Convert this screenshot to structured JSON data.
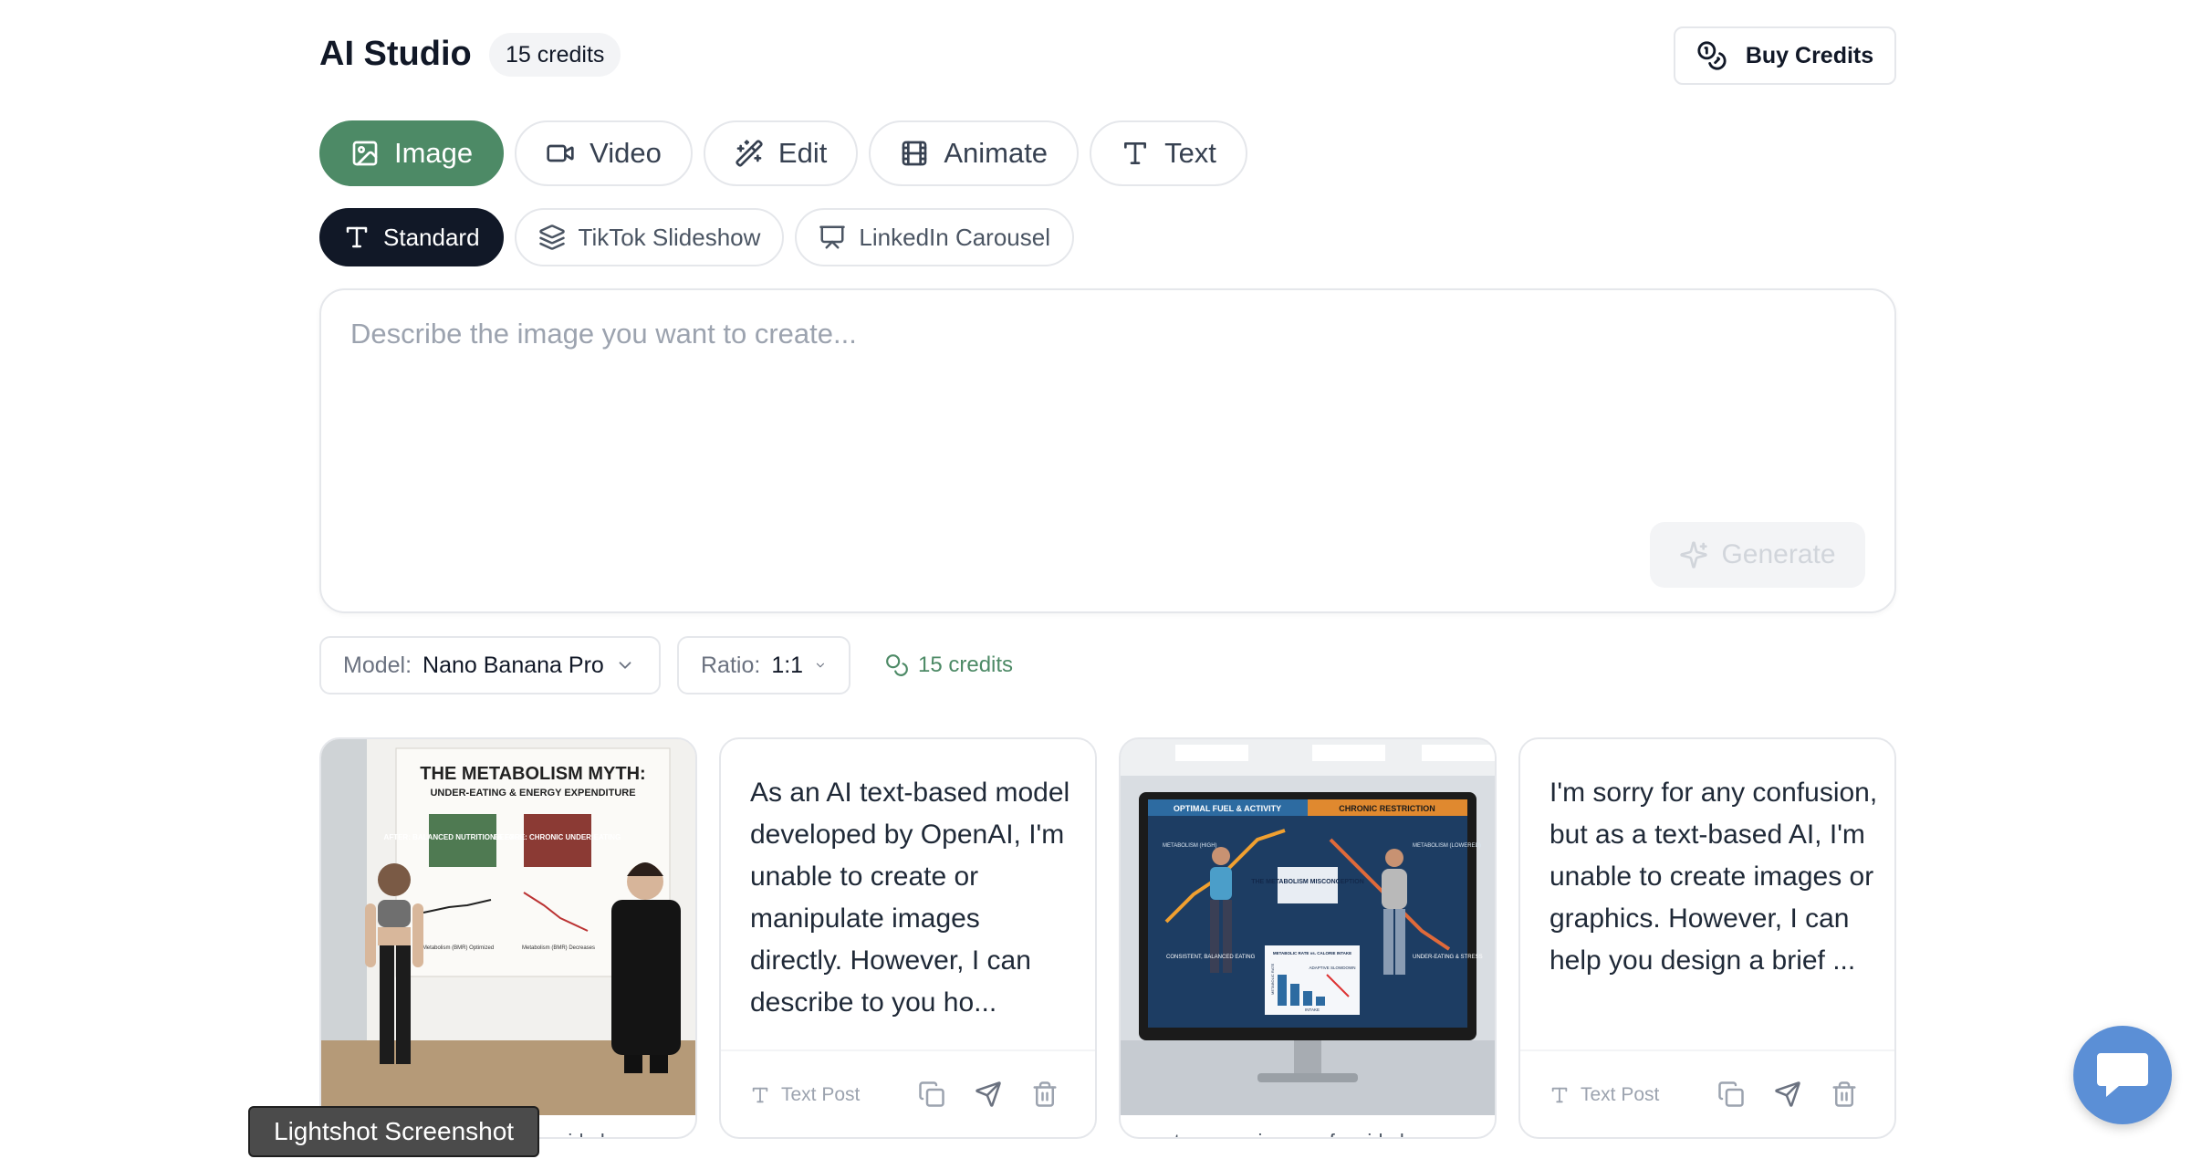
{
  "header": {
    "title": "AI Studio",
    "credits_badge": "15 credits",
    "buy_credits_label": "Buy Credits"
  },
  "tabs": [
    {
      "label": "Image",
      "icon": "image-icon",
      "active": true
    },
    {
      "label": "Video",
      "icon": "video-icon",
      "active": false
    },
    {
      "label": "Edit",
      "icon": "wand-icon",
      "active": false
    },
    {
      "label": "Animate",
      "icon": "film-icon",
      "active": false
    },
    {
      "label": "Text",
      "icon": "text-icon",
      "active": false
    }
  ],
  "subtabs": [
    {
      "label": "Standard",
      "icon": "text-icon",
      "active": true
    },
    {
      "label": "TikTok Slideshow",
      "icon": "layers-icon",
      "active": false
    },
    {
      "label": "LinkedIn Carousel",
      "icon": "presentation-icon",
      "active": false
    }
  ],
  "prompt": {
    "placeholder": "Describe the image you want to create...",
    "value": "",
    "generate_label": "Generate"
  },
  "options": {
    "model_label": "Model:",
    "model_value": "Nano Banana Pro",
    "ratio_label": "Ratio:",
    "ratio_value": "1:1",
    "credits": "15 credits"
  },
  "cards": [
    {
      "type": "image",
      "caption": "create me an image of a side by...",
      "poster": {
        "title": "THE METABOLISM MYTH:",
        "subtitle": "UNDER-EATING & ENERGY EXPENDITURE",
        "after": "AFTER: BALANCED NUTRITION & EXERCISE",
        "before": "BEFORE: CHRONIC UNDER-EATING",
        "left_note": "Metabolism (BMR) Optimized",
        "right_note": "Metabolism (BMR) Decreases"
      }
    },
    {
      "type": "text",
      "text": "As an AI text-based model developed by OpenAI, I'm unable to create or manipulate images directly. However, I can describe to you ho...",
      "footer_label": "Text Post"
    },
    {
      "type": "image",
      "caption": "create me an image of a side by...",
      "poster": {
        "left_head": "OPTIMAL FUEL & ACTIVITY",
        "right_head": "CHRONIC RESTRICTION",
        "center": "THE METABOLISM MISCONCEPTION",
        "left_top": "METABOLISM (HIGH)",
        "right_top": "METABOLISM (LOWERED)",
        "left_bottom": "CONSISTENT, BALANCED EATING",
        "right_bottom": "UNDER-EATING & STRESS",
        "chart_label": "METABOLIC RATE vs. CALORIE INTAKE",
        "adaptive": "ADAPTIVE SLOWDOWN",
        "metabolic_rate": "METABOLIC RATE",
        "intake": "INTAKE"
      }
    },
    {
      "type": "text",
      "text": "I'm sorry for any confusion, but as a text-based AI, I'm unable to create images or graphics. However, I can help you design a brief ...",
      "footer_label": "Text Post"
    }
  ],
  "overlay": {
    "tooltip": "Lightshot Screenshot",
    "chat_icon": "chat-icon"
  },
  "colors": {
    "accent": "#4d8a66",
    "dark": "#111827",
    "chat": "#5b8fd6"
  }
}
